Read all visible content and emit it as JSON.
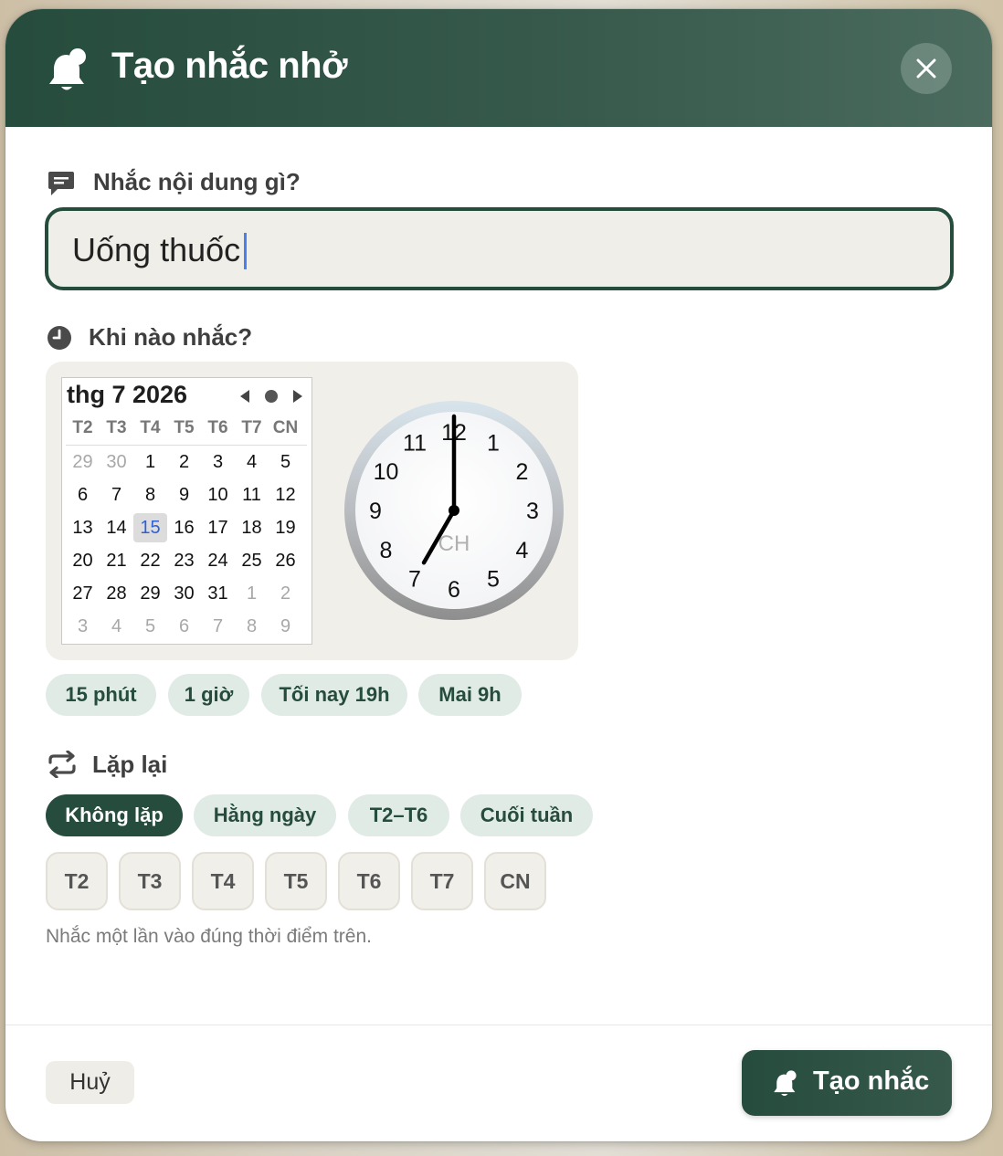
{
  "header": {
    "title": "Tạo nhắc nhở",
    "icon": "bell-icon",
    "close_icon": "close-icon"
  },
  "content": {
    "label": "Nhắc nội dung gì?",
    "icon": "message-icon",
    "value": "Uống thuốc"
  },
  "when": {
    "label": "Khi nào nhắc?",
    "icon": "clock-icon",
    "calendar": {
      "title": "thg 7 2026",
      "weekday_headers": [
        "T2",
        "T3",
        "T4",
        "T5",
        "T6",
        "T7",
        "CN"
      ],
      "weeks": [
        [
          "29",
          "30",
          "1",
          "2",
          "3",
          "4",
          "5"
        ],
        [
          "6",
          "7",
          "8",
          "9",
          "10",
          "11",
          "12"
        ],
        [
          "13",
          "14",
          "15",
          "16",
          "17",
          "18",
          "19"
        ],
        [
          "20",
          "21",
          "22",
          "23",
          "24",
          "25",
          "26"
        ],
        [
          "27",
          "28",
          "29",
          "30",
          "31",
          "1",
          "2"
        ],
        [
          "3",
          "4",
          "5",
          "6",
          "7",
          "8",
          "9"
        ]
      ],
      "selected_day": "15"
    },
    "clock": {
      "numbers": [
        "12",
        "1",
        "2",
        "3",
        "4",
        "5",
        "6",
        "7",
        "8",
        "9",
        "10",
        "11"
      ],
      "period": "CH",
      "hour": 7,
      "minute": 0
    },
    "quick_options": [
      "15 phút",
      "1 giờ",
      "Tối nay 19h",
      "Mai 9h"
    ]
  },
  "repeat": {
    "label": "Lặp lại",
    "icon": "repeat-icon",
    "options": [
      "Không lặp",
      "Hằng ngày",
      "T2–T6",
      "Cuối tuần"
    ],
    "selected": "Không lặp",
    "weekdays": [
      "T2",
      "T3",
      "T4",
      "T5",
      "T6",
      "T7",
      "CN"
    ],
    "hint": "Nhắc một lần vào đúng thời điểm trên."
  },
  "footer": {
    "cancel_label": "Huỷ",
    "create_label": "Tạo nhắc",
    "create_icon": "bell-icon"
  },
  "colors": {
    "primary": "#264c3d",
    "chip_bg": "#e0ebe5",
    "field_bg": "#f0eee8",
    "selected_date": "#2f5fd8"
  }
}
